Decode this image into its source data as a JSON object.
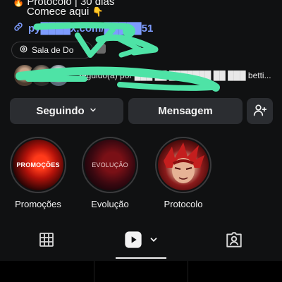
{
  "bio": {
    "line1": "Protocolo | 30 dias",
    "line1_emoji": "🔥",
    "line2": "Comece aqui",
    "line2_emoji": "👇",
    "link": "py████x.com/█████51"
  },
  "chip": {
    "label": "Sala de Do",
    "icon": "threads-icon"
  },
  "followers": {
    "text": "Seguido(a) por ███ ██ ███████ ██ ███ betti..."
  },
  "buttons": {
    "follow_label": "Seguindo",
    "message_label": "Mensagem",
    "add_icon": "add-person-icon"
  },
  "highlights": [
    {
      "cover_text": "PROMOÇÕES",
      "label": "Promoções"
    },
    {
      "cover_text": "EVOLUÇÃO",
      "label": "Evolução"
    },
    {
      "cover_text": "",
      "label": "Protocolo"
    }
  ],
  "tabs": {
    "items": [
      {
        "name": "grid",
        "icon": "grid-icon"
      },
      {
        "name": "reels",
        "icon": "reels-icon",
        "active": true
      },
      {
        "name": "tagged",
        "icon": "tagged-icon"
      }
    ]
  },
  "colors": {
    "background": "#101112",
    "button": "#2b2d31",
    "link": "#7e9cff",
    "scribble": "#4ee3a6"
  }
}
